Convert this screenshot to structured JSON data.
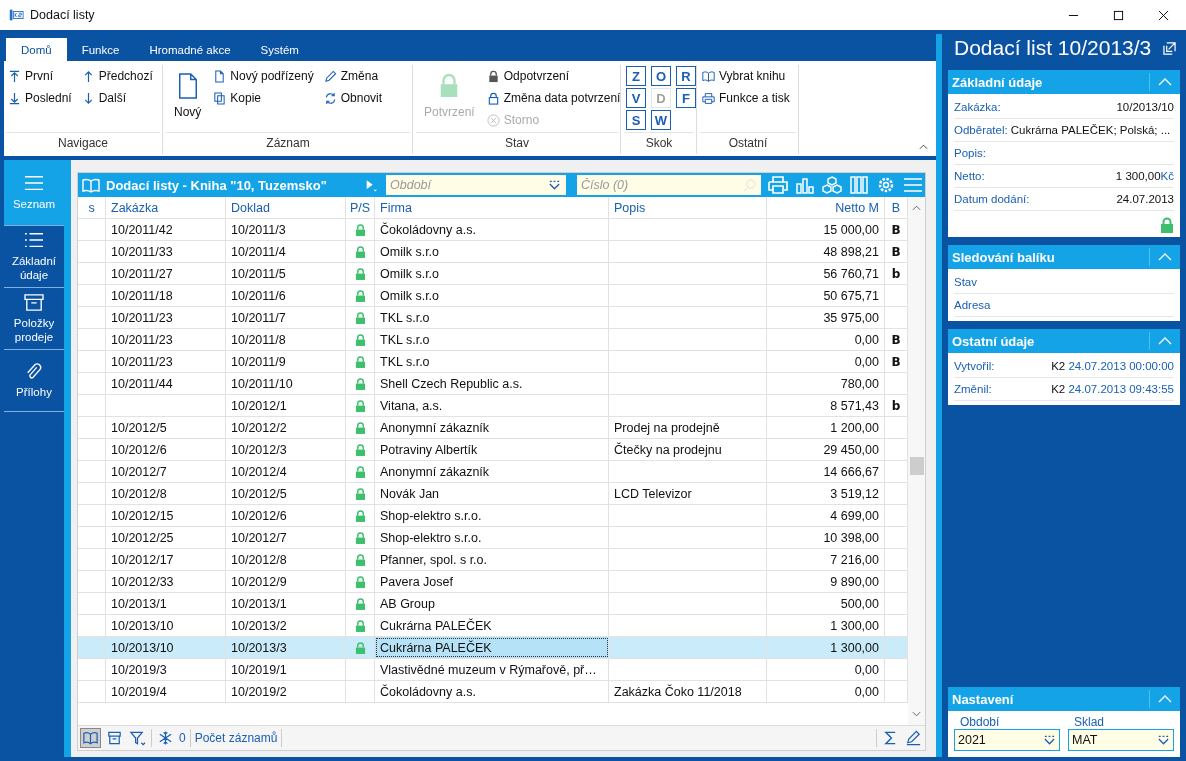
{
  "window": {
    "title": "Dodací listy"
  },
  "ribbon": {
    "tabs": [
      {
        "label": "Domů",
        "selected": true
      },
      {
        "label": "Funkce",
        "selected": false
      },
      {
        "label": "Hromadné akce",
        "selected": false
      },
      {
        "label": "Systém",
        "selected": false
      }
    ],
    "groups": [
      {
        "kind": "nav",
        "title": "Navigace",
        "items": [
          {
            "label": "První"
          },
          {
            "label": "Předchozí"
          },
          {
            "label": "Poslední"
          },
          {
            "label": "Další"
          }
        ]
      },
      {
        "kind": "record",
        "title": "Záznam",
        "large": {
          "label": "Nový",
          "disabled": false
        },
        "items": [
          {
            "label": "Nový podřízený"
          },
          {
            "label": "Kopie"
          },
          {
            "label": "Změna"
          },
          {
            "label": "Obnovit"
          }
        ]
      },
      {
        "kind": "state",
        "title": "Stav",
        "large": {
          "label": "Potvrzení",
          "disabled": true
        },
        "items": [
          {
            "label": "Odpotvrzení",
            "disabled": false
          },
          {
            "label": "Změna data potvrzení",
            "disabled": false
          },
          {
            "label": "Storno",
            "disabled": true
          }
        ]
      },
      {
        "kind": "jump",
        "title": "Skok",
        "items": [
          {
            "label": "Z",
            "disabled": false
          },
          {
            "label": "O",
            "disabled": false
          },
          {
            "label": "R",
            "disabled": false
          },
          {
            "label": "V",
            "disabled": false
          },
          {
            "label": "D",
            "disabled": true
          },
          {
            "label": "F",
            "disabled": false
          },
          {
            "label": "S",
            "disabled": false
          },
          {
            "label": "W",
            "disabled": false
          }
        ]
      },
      {
        "kind": "other",
        "title": "Ostatní",
        "items": [
          {
            "label": "Vybrat knihu"
          },
          {
            "label": "Funkce a tisk"
          }
        ]
      }
    ]
  },
  "sidebar": {
    "items": [
      {
        "label": "Seznam",
        "selected": true
      },
      {
        "label": "Základní údaje",
        "selected": false
      },
      {
        "label": "Položky prodeje",
        "selected": false
      },
      {
        "label": "Přílohy",
        "selected": false
      }
    ]
  },
  "grid": {
    "title": "Dodací listy - Kniha \"10, Tuzemsko\"",
    "period_field": {
      "placeholder": "Období"
    },
    "number_field": {
      "placeholder": "Číslo (0)"
    },
    "columns": [
      "s",
      "Zakázka",
      "Doklad",
      "P/S",
      "Firma",
      "Popis",
      "Netto M",
      "B"
    ],
    "rows": [
      {
        "zakazka": "10/2011/42",
        "doklad": "10/2011/3",
        "locked": true,
        "firma": "Čokoládovny a.s.",
        "netto": "15 000,00",
        "b": "B",
        "selected": false
      },
      {
        "zakazka": "10/2011/33",
        "doklad": "10/2011/4",
        "locked": true,
        "firma": "Omilk s.r.o",
        "netto": "48 898,21",
        "b": "B",
        "selected": false
      },
      {
        "zakazka": "10/2011/27",
        "doklad": "10/2011/5",
        "locked": true,
        "firma": "Omilk s.r.o",
        "netto": "56 760,71",
        "b": "b",
        "selected": false
      },
      {
        "zakazka": "10/2011/18",
        "doklad": "10/2011/6",
        "locked": true,
        "firma": "Omilk s.r.o",
        "netto": "50 675,71",
        "selected": false
      },
      {
        "zakazka": "10/2011/23",
        "doklad": "10/2011/7",
        "locked": true,
        "firma": "TKL s.r.o",
        "netto": "35 975,00",
        "selected": false
      },
      {
        "zakazka": "10/2011/23",
        "doklad": "10/2011/8",
        "locked": true,
        "firma": "TKL s.r.o",
        "netto": "0,00",
        "b": "B",
        "selected": false
      },
      {
        "zakazka": "10/2011/23",
        "doklad": "10/2011/9",
        "locked": true,
        "firma": "TKL s.r.o",
        "netto": "0,00",
        "b": "B",
        "selected": false
      },
      {
        "zakazka": "10/2011/44",
        "doklad": "10/2011/10",
        "locked": true,
        "firma": "Shell Czech Republic a.s.",
        "netto": "780,00",
        "selected": false
      },
      {
        "doklad": "10/2012/1",
        "locked": true,
        "firma": "Vitana, a.s.",
        "netto": "8 571,43",
        "b": "b",
        "selected": false
      },
      {
        "zakazka": "10/2012/5",
        "doklad": "10/2012/2",
        "locked": true,
        "firma": "Anonymní zákazník",
        "popis": "Prodej na prodejně",
        "netto": "1 200,00",
        "selected": false
      },
      {
        "zakazka": "10/2012/6",
        "doklad": "10/2012/3",
        "locked": true,
        "firma": "Potraviny Albertík",
        "popis": "Čtečky na prodejnu",
        "netto": "29 450,00",
        "selected": false
      },
      {
        "zakazka": "10/2012/7",
        "doklad": "10/2012/4",
        "locked": true,
        "firma": "Anonymní zákazník",
        "netto": "14 666,67",
        "selected": false
      },
      {
        "zakazka": "10/2012/8",
        "doklad": "10/2012/5",
        "locked": true,
        "firma": "Novák Jan",
        "popis": "LCD Televizor",
        "netto": "3 519,12",
        "selected": false
      },
      {
        "zakazka": "10/2012/15",
        "doklad": "10/2012/6",
        "locked": true,
        "firma": "Shop-elektro s.r.o.",
        "netto": "4 699,00",
        "selected": false
      },
      {
        "zakazka": "10/2012/25",
        "doklad": "10/2012/7",
        "locked": true,
        "firma": "Shop-elektro s.r.o.",
        "netto": "10 398,00",
        "selected": false
      },
      {
        "zakazka": "10/2012/17",
        "doklad": "10/2012/8",
        "locked": true,
        "firma": "Pfanner, spol. s r.o.",
        "netto": "7 216,00",
        "selected": false
      },
      {
        "zakazka": "10/2012/33",
        "doklad": "10/2012/9",
        "locked": true,
        "firma": "Pavera Josef",
        "netto": "9 890,00",
        "selected": false
      },
      {
        "zakazka": "10/2013/1",
        "doklad": "10/2013/1",
        "locked": true,
        "firma": "AB Group",
        "netto": "500,00",
        "selected": false
      },
      {
        "zakazka": "10/2013/10",
        "doklad": "10/2013/2",
        "locked": true,
        "firma": "Cukrárna PALEČEK",
        "netto": "1 300,00",
        "selected": false
      },
      {
        "zakazka": "10/2013/10",
        "doklad": "10/2013/3",
        "locked": true,
        "firma": "Cukrárna PALEČEK",
        "netto": "1 300,00",
        "selected": true
      },
      {
        "zakazka": "10/2019/3",
        "doklad": "10/2019/1",
        "locked": false,
        "firma": "Vlastivědné muzeum v Rýmařově, př…",
        "netto": "0,00",
        "selected": false
      },
      {
        "zakazka": "10/2019/4",
        "doklad": "10/2019/2",
        "locked": false,
        "firma": "Čokoládovny a.s.",
        "popis": "Zakázka Čoko 11/2018",
        "netto": "0,00",
        "selected": false
      }
    ],
    "footer": {
      "count": "0",
      "link": "Počet záznamů"
    }
  },
  "detail": {
    "title": "Dodací list 10/2013/3",
    "sections": [
      {
        "title": "Základní údaje",
        "locked": true,
        "fields": [
          {
            "kind": "right",
            "label": "Zakázka:",
            "value": "10/2013/10"
          },
          {
            "kind": "inline",
            "label": "Odběratel:",
            "value": "Cukrárna PALEČEK; Polská; ..."
          },
          {
            "kind": "right",
            "label": "Popis:"
          },
          {
            "kind": "right",
            "label": "Netto:",
            "value": "1 300,00",
            "unit": "Kč"
          },
          {
            "kind": "right",
            "label": "Datum dodání:",
            "value": "24.07.2013"
          }
        ]
      },
      {
        "title": "Sledování balíku",
        "locked": false,
        "fields": [
          {
            "kind": "right",
            "label": "Stav"
          },
          {
            "kind": "right",
            "label": "Adresa"
          }
        ]
      },
      {
        "title": "Ostatní údaje",
        "locked": false,
        "fields": [
          {
            "kind": "stamp",
            "label": "Vytvořil:",
            "user": "K2",
            "value": "24.07.2013 00:00:00"
          },
          {
            "kind": "stamp",
            "label": "Změnil:",
            "user": "K2",
            "value": "24.07.2013 09:43:55"
          }
        ]
      }
    ],
    "settings": {
      "title": "Nastavení",
      "fields": [
        {
          "label": "Období",
          "value": "2021"
        },
        {
          "label": "Sklad",
          "value": "MAT"
        }
      ]
    }
  }
}
